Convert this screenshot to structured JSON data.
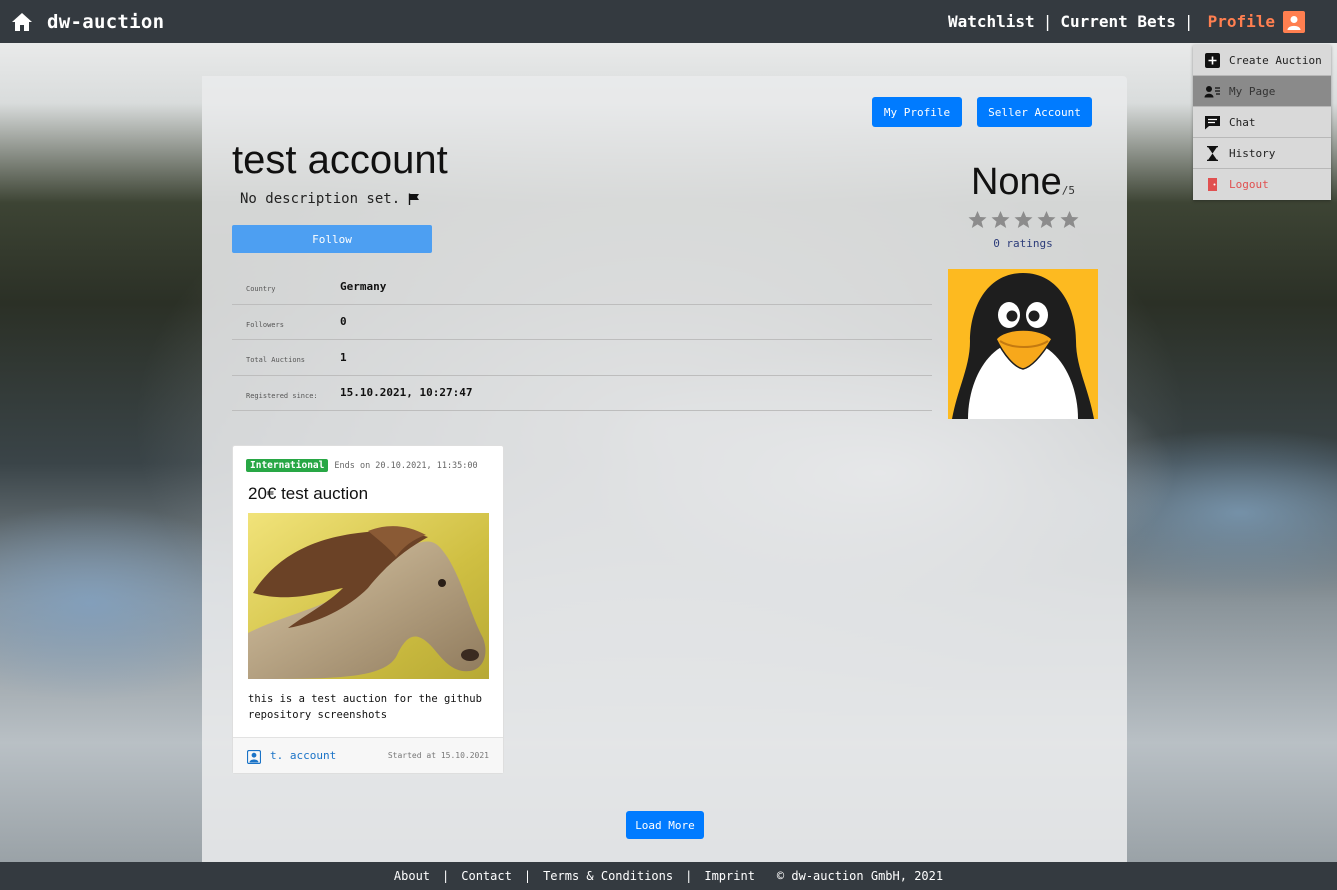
{
  "nav": {
    "brand": "dw-auction",
    "watchlist": "Watchlist",
    "current_bets": "Current Bets",
    "separator": "|",
    "profile": "Profile"
  },
  "dropdown": {
    "items": [
      {
        "label": "Create Auction",
        "icon": "plus-box-icon"
      },
      {
        "label": "My Page",
        "icon": "user-card-icon"
      },
      {
        "label": "Chat",
        "icon": "chat-icon"
      },
      {
        "label": "History",
        "icon": "hourglass-icon"
      },
      {
        "label": "Logout",
        "icon": "logout-icon"
      }
    ]
  },
  "profile": {
    "my_profile_btn": "My Profile",
    "seller_account_btn": "Seller Account",
    "name": "test account",
    "description": "No description set.",
    "follow_btn": "Follow",
    "info": [
      {
        "key": "Country",
        "value": "Germany"
      },
      {
        "key": "Followers",
        "value": "0"
      },
      {
        "key": "Total Auctions",
        "value": "1"
      },
      {
        "key": "Registered since:",
        "value": "15.10.2021, 10:27:47"
      }
    ],
    "rating": "None",
    "rating_max": "/5",
    "ratings_count": "0 ratings"
  },
  "auction": {
    "badge": "International",
    "ends": "Ends on 20.10.2021, 11:35:00",
    "title": "20€ test auction",
    "description": "this is a test auction for the github repository screenshots",
    "seller": "t. account",
    "started": "Started at 15.10.2021"
  },
  "load_more": "Load More",
  "footer": {
    "about": "About",
    "contact": "Contact",
    "terms": "Terms & Conditions",
    "imprint": "Imprint",
    "separator": "|",
    "copyright": "© dw-auction GmbH, 2021"
  },
  "colors": {
    "navbar": "#343a40",
    "primary": "#007bff",
    "profile_accent": "#ff7f50",
    "badge_green": "#28a745",
    "logout_red": "#e05050"
  }
}
